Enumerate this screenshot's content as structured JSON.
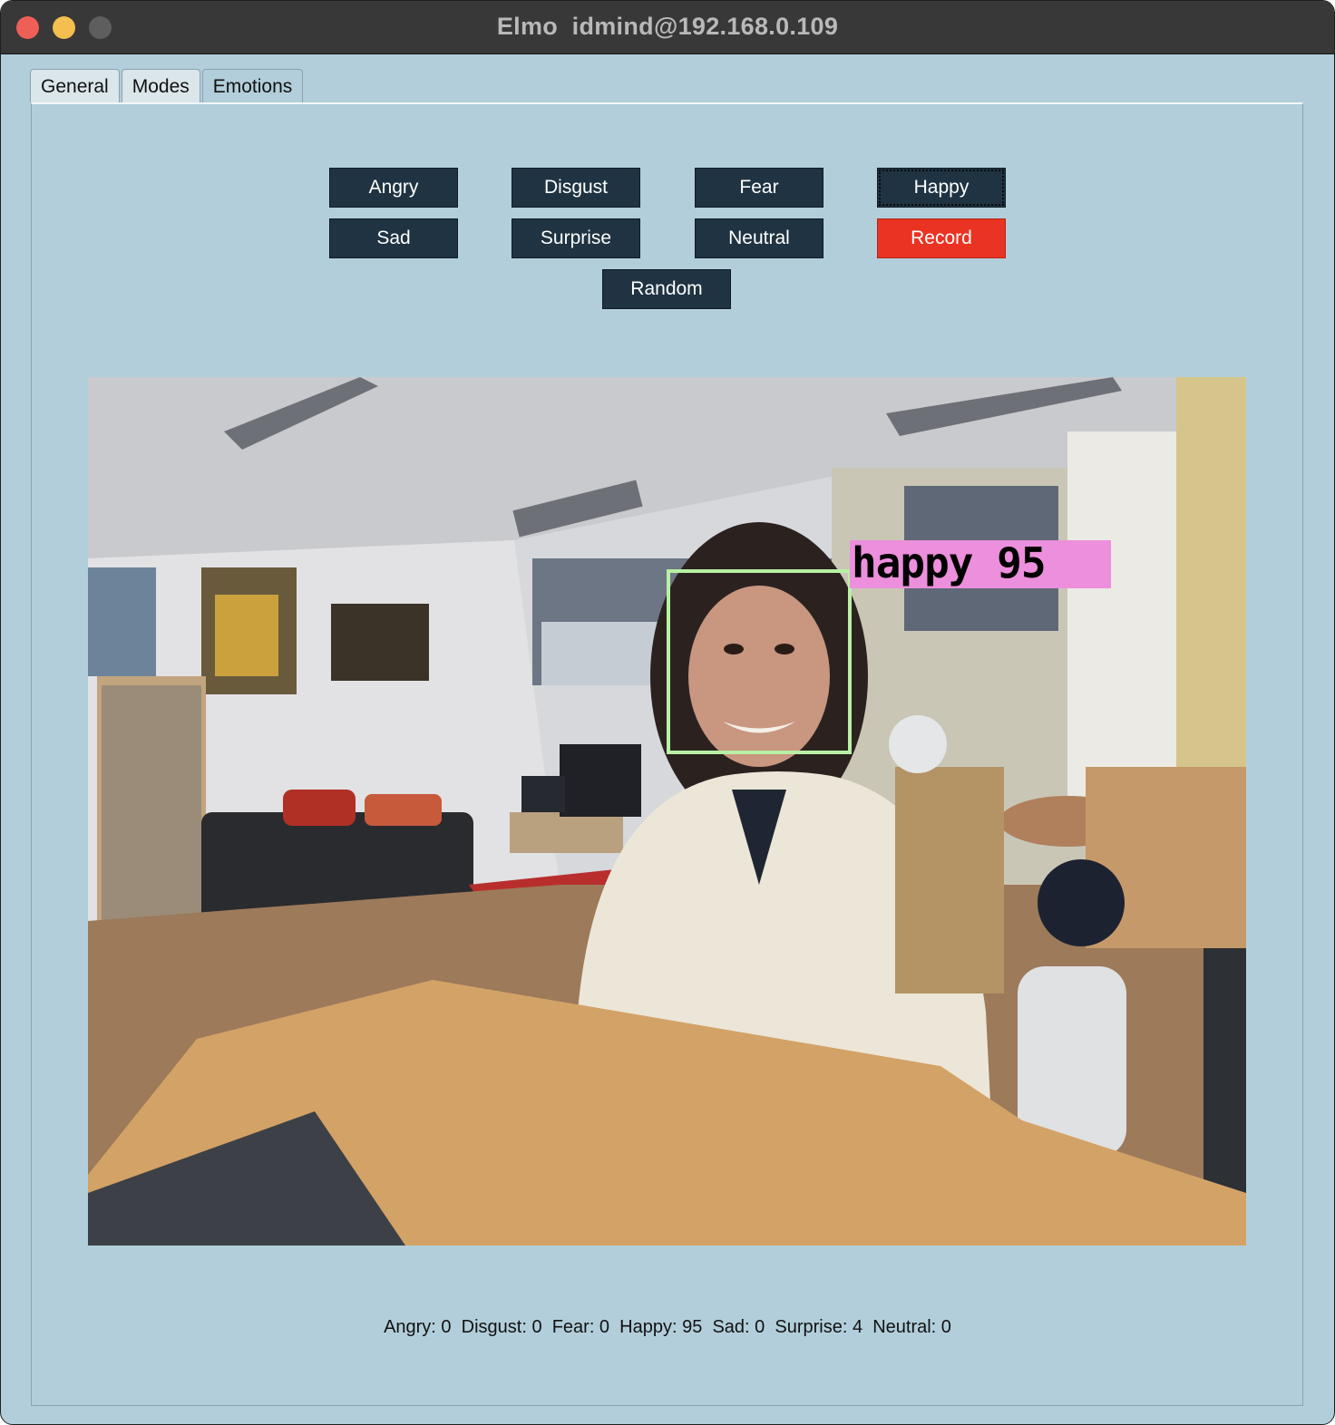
{
  "window": {
    "title": "Elmo  idmind@192.168.0.109"
  },
  "tabs": [
    {
      "label": "General",
      "active": false
    },
    {
      "label": "Modes",
      "active": false
    },
    {
      "label": "Emotions",
      "active": true
    }
  ],
  "buttons": {
    "angry": "Angry",
    "disgust": "Disgust",
    "fear": "Fear",
    "happy": "Happy",
    "sad": "Sad",
    "surprise": "Surprise",
    "neutral": "Neutral",
    "record": "Record",
    "random": "Random"
  },
  "camera": {
    "detection_label": "happy 95"
  },
  "scores_text": "Angry: 0  Disgust: 0  Fear: 0  Happy: 95  Sad: 0  Surprise: 4  Neutral: 0",
  "colors": {
    "background": "#b2cedb",
    "button": "#1f3342",
    "record_button": "#ea3323",
    "face_box": "#b8f0a4",
    "label_bg": "#ec8fdc"
  }
}
